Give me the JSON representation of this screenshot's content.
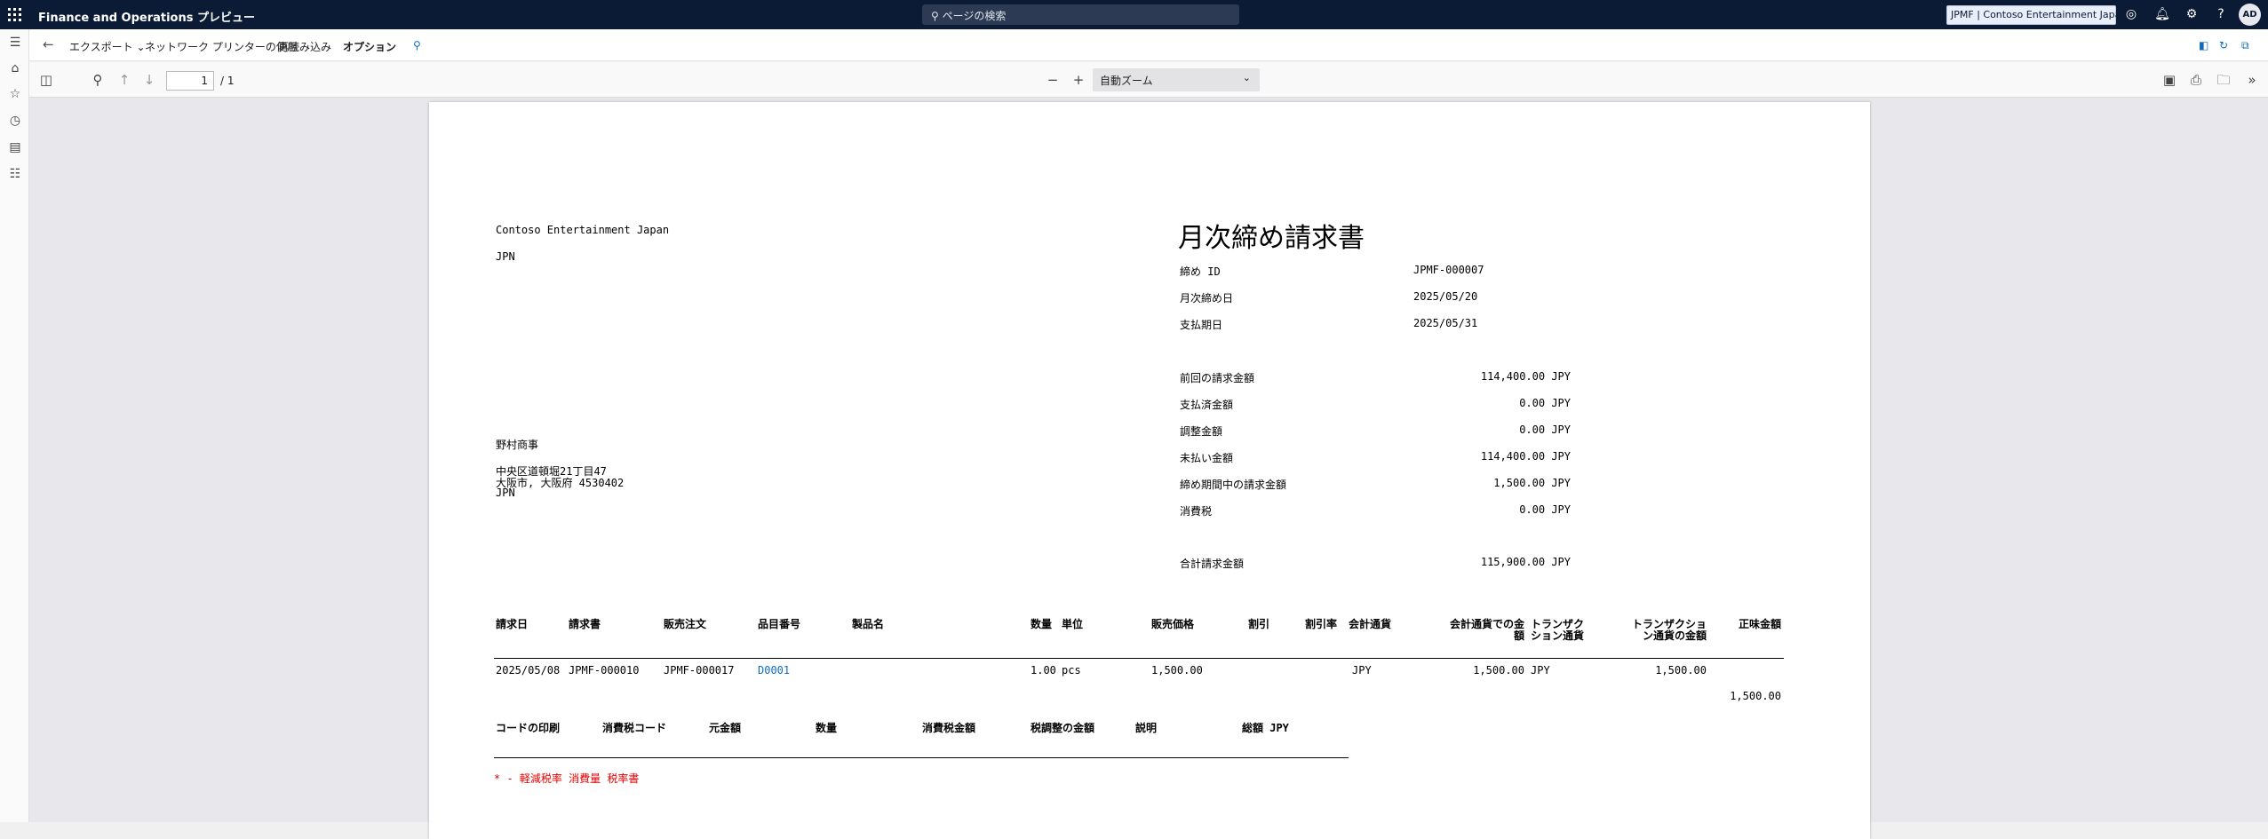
{
  "topbar": {
    "title": "Finance and Operations プレビュー",
    "search_placeholder": "ページの検索",
    "company": "JPMF | Contoso Entertainment Japan",
    "avatar": "AD"
  },
  "actions": {
    "export": "エクスポート",
    "network_printer": "ネットワーク プリンターの使用",
    "reload": "再読み込み",
    "options": "オプション"
  },
  "pdfbar": {
    "page_current": "1",
    "page_total": "/ 1",
    "zoom": "自動ズーム"
  },
  "invoice": {
    "company_name": "Contoso Entertainment Japan",
    "company_country": "JPN",
    "title": "月次締め請求書",
    "meta": [
      {
        "label": "締め ID",
        "value": "JPMF-000007"
      },
      {
        "label": "月次締め日",
        "value": "2025/05/20"
      },
      {
        "label": "支払期日",
        "value": "2025/05/31"
      }
    ],
    "amounts": [
      {
        "label": "前回の請求金額",
        "value": "114,400.00 JPY"
      },
      {
        "label": "支払済金額",
        "value": "0.00 JPY"
      },
      {
        "label": "調整金額",
        "value": "0.00 JPY"
      },
      {
        "label": "未払い金額",
        "value": "114,400.00 JPY"
      },
      {
        "label": "締め期間中の請求金額",
        "value": "1,500.00 JPY"
      },
      {
        "label": "消費税",
        "value": "0.00 JPY"
      }
    ],
    "total": {
      "label": "合計請求金額",
      "value": "115,900.00 JPY"
    },
    "customer": {
      "name": "野村商事",
      "address1": "中央区道頓堀21丁目47",
      "address2": "大阪市, 大阪府 4530402",
      "country": "JPN"
    },
    "table_headers": {
      "invoice_date": "請求日",
      "invoice": "請求書",
      "sales_order": "販売注文",
      "item_number": "品目番号",
      "product_name": "製品名",
      "quantity": "数量",
      "unit": "単位",
      "sales_price": "販売価格",
      "discount": "割引",
      "discount_rate": "割引率",
      "accounting_currency": "会計通貨",
      "amount_accounting_1": "会計通貨での金",
      "amount_accounting_2": "額",
      "transaction_currency_1": "トランザク",
      "transaction_currency_2": "ション通貨",
      "amount_transaction_1": "トランザクショ",
      "amount_transaction_2": "ン通貨の金額",
      "net_amount": "正味金額"
    },
    "row": {
      "invoice_date": "2025/05/08",
      "invoice": "JPMF-000010",
      "sales_order": "JPMF-000017",
      "item_number": "D0001",
      "quantity": "1.00",
      "unit": "pcs",
      "sales_price": "1,500.00",
      "accounting_currency": "JPY",
      "amount_accounting": "1,500.00",
      "transaction_currency": "JPY",
      "amount_transaction": "1,500.00"
    },
    "subtotal": "1,500.00",
    "tax_headers": {
      "code_print": "コードの印刷",
      "tax_code": "消費税コード",
      "base_amount": "元金額",
      "quantity": "数量",
      "tax_amount": "消費税金額",
      "tax_adjustment": "税調整の金額",
      "description": "説明",
      "total": "総額 JPY"
    },
    "footnote": "* - 軽減税率 消費量 税率書"
  },
  "colors": {
    "topbar": "#0b1a35",
    "link": "#0f6cbd",
    "footnote": "#e60000"
  }
}
